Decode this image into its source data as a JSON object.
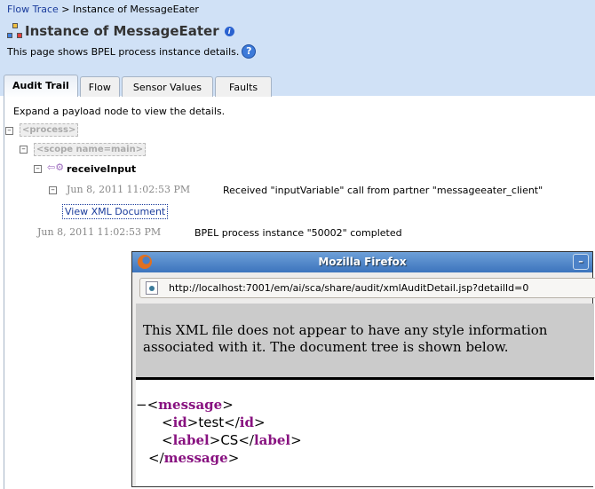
{
  "breadcrumb": {
    "link": "Flow Trace",
    "separator": ">",
    "current": "Instance of MessageEater"
  },
  "page": {
    "title": "Instance of MessageEater",
    "description": "This page shows BPEL process instance details."
  },
  "tabs": [
    {
      "label": "Audit Trail",
      "active": true
    },
    {
      "label": "Flow"
    },
    {
      "label": "Sensor Values"
    },
    {
      "label": "Faults"
    }
  ],
  "audit": {
    "hint": "Expand a payload node to view the details.",
    "process_node": "<process>",
    "scope_node": "<scope name=main>",
    "activity": "receiveInput",
    "event1": {
      "date": "Jun 8, 2011 11:02:53 PM",
      "text": "Received \"inputVariable\" call from partner \"messageeater_client\"",
      "link": "View XML Document"
    },
    "event2": {
      "date": "Jun 8, 2011 11:02:53 PM",
      "text": "BPEL process instance \"50002\" completed"
    }
  },
  "popup": {
    "title": "Mozilla Firefox",
    "minimize": "–",
    "url": "http://localhost:7001/em/ai/sca/share/audit/xmlAuditDetail.jsp?detailId=0",
    "notice": "This XML file does not appear to have any style information associated with it. The document tree is shown below.",
    "xml": {
      "root": "message",
      "id_tag": "id",
      "id_value": "test",
      "label_tag": "label",
      "label_value": "CS"
    },
    "tag_color": "#881280"
  }
}
